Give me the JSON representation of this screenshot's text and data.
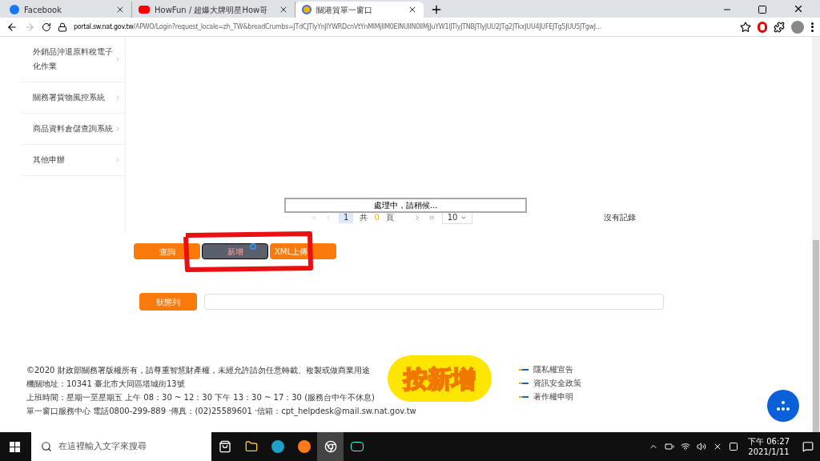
{
  "browser": {
    "tabs": [
      {
        "label": "Facebook",
        "selected": false
      },
      {
        "label": "HowFun / 超爆大牌明星How哥",
        "selected": false
      },
      {
        "label": "關港貿單一窗口",
        "selected": true
      }
    ],
    "url_host": "portal.sw.nat.gov.tw",
    "url_path": "/APWO/Login?request_locale=zh_TW&breadCrumbs=JTdCJTlyYnJlYWRDcnVtYnMlMjIlM0ElNUIlN0IlMjJuYW1lJTlyJTNBJTlyJUU2JTg2JTkxJUU4JUFEJTg5JUU5JTgwJ..."
  },
  "sidebar": {
    "items": [
      {
        "label": "外銷品沖退原料稅電子化作業"
      },
      {
        "label": "關務署貨物風控系統"
      },
      {
        "label": "商品資料倉儲查詢系統"
      },
      {
        "label": "其他申辦"
      }
    ]
  },
  "loading": {
    "text": "處理中，請稍候..."
  },
  "pager": {
    "page": "1",
    "total_prefix": "共",
    "total": "0",
    "total_suffix": "頁",
    "page_size": "10",
    "empty_text": "沒有記錄"
  },
  "buttons": [
    {
      "label": "查詢",
      "pressed": false
    },
    {
      "label": "新增",
      "pressed": true
    },
    {
      "label": "XML上傳",
      "pressed": false
    }
  ],
  "status": {
    "label": "狀態列"
  },
  "annotation": {
    "caption": "按新增"
  },
  "footer": {
    "lines": [
      "©2020 財政部關務署版權所有，請尊重智慧財產權，未經允許請勿任意轉載、複製或做商業用途",
      "機關地址：10341 臺北市大同區塔城街13號",
      "上班時間：星期一至星期五 上午 08：30 ~ 12：30 下午 13：30 ~ 17：30 (服務台中午不休息)",
      "單一窗口服務中心 電話0800-299-889 ‧傳真：(02)25589601 ‧信箱：cpt_helpdesk@mail.sw.nat.gov.tw"
    ],
    "links": [
      "隱私權宣告",
      "資訊安全政策",
      "著作權申明"
    ]
  },
  "taskbar": {
    "search_placeholder": "在這裡輸入文字來搜尋",
    "time": "下午 06:27",
    "date": "2021/1/11"
  }
}
